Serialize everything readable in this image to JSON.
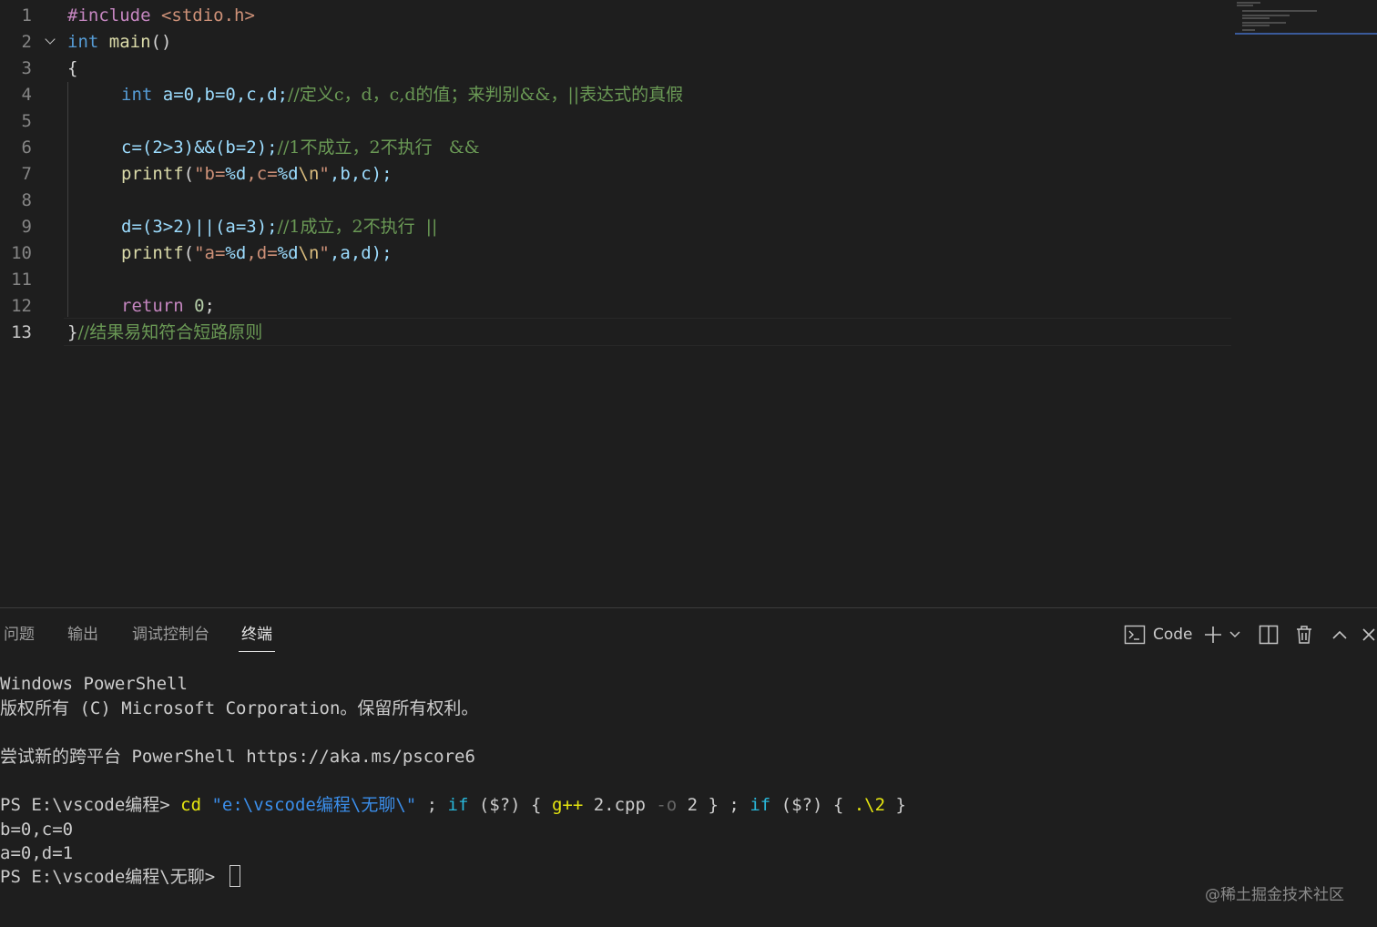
{
  "editor": {
    "line_numbers": [
      "1",
      "2",
      "3",
      "4",
      "5",
      "6",
      "7",
      "8",
      "9",
      "10",
      "11",
      "12",
      "13"
    ],
    "line1": {
      "directive": "#include",
      "header": " <stdio.h>"
    },
    "line2": {
      "type": "int",
      "fn": "main",
      "rest": "()"
    },
    "line3": {
      "text": "{"
    },
    "line4": {
      "type": "int",
      "code": " a=0,b=0,c,d;",
      "comment": "//定义c，d，c,d的值；来判别&&，||表达式的真假"
    },
    "line6": {
      "code": "c=(2>3)&&(b=2);",
      "comment": "//1不成立，2不执行   &&"
    },
    "line7": {
      "fn": "printf",
      "open": "(",
      "q1": "\"b=",
      "f1": "%d",
      "q2": ",c=",
      "f2": "%d",
      "esc": "\\n",
      "q3": "\"",
      "args": ",b,c);"
    },
    "line9": {
      "code": "d=(3>2)||(a=3);",
      "comment": "//1成立，2不执行  ||"
    },
    "line10": {
      "fn": "printf",
      "open": "(",
      "q1": "\"a=",
      "f1": "%d",
      "q2": ",d=",
      "f2": "%d",
      "esc": "\\n",
      "q3": "\"",
      "args": ",a,d);"
    },
    "line12": {
      "kw": "return",
      "num": "0",
      "end": ";"
    },
    "line13": {
      "brace": "}",
      "comment": "//结果易知符合短路原则"
    }
  },
  "panel": {
    "tabs": [
      "问题",
      "输出",
      "调试控制台",
      "终端"
    ],
    "active_tab": "终端",
    "terminal_profile": "Code",
    "icons": [
      "terminal-icon",
      "plus-icon",
      "chevron-down-icon",
      "split-icon",
      "trash-icon",
      "chevron-up-icon",
      "close-icon"
    ]
  },
  "terminal": {
    "line1": "Windows PowerShell",
    "line2": "版权所有 (C) Microsoft Corporation。保留所有权利。",
    "line4": "尝试新的跨平台 PowerShell https://aka.ms/pscore6",
    "cmd": {
      "prompt": "PS E:\\vscode编程> ",
      "cd": "cd",
      "path": " \"e:\\vscode编程\\无聊\\\"",
      "sep1": " ; ",
      "if1": "if",
      "cond1": " ($?) { ",
      "gpp": "g++",
      "file": " 2.cpp ",
      "flag": "-o",
      "out": " 2 } ; ",
      "if2": "if",
      "cond2": " ($?) { ",
      "run": ".\\2",
      "close": " }"
    },
    "out1": "b=0,c=0",
    "out2": "a=0,d=1",
    "prompt_final": "PS E:\\vscode编程\\无聊> "
  },
  "watermark": "@稀土掘金技术社区",
  "colors": {
    "background": "#1e1e1e",
    "keyword": "#569cd6",
    "comment": "#6a9955",
    "string": "#ce9178",
    "function": "#dcdcaa",
    "terminal_command": "#e5e510",
    "terminal_string": "#3b8eea"
  }
}
